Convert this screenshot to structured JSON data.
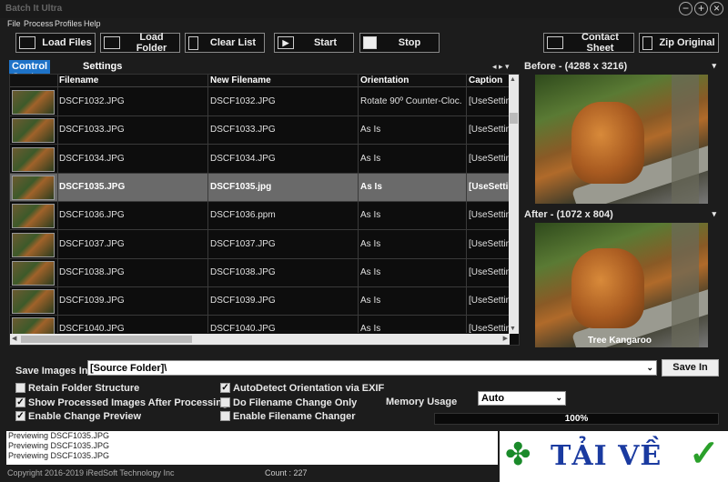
{
  "window": {
    "title": "Batch It Ultra",
    "controls": [
      "−",
      "+",
      "×"
    ]
  },
  "menu": [
    "File",
    "Process",
    "Profiles",
    "Help"
  ],
  "toolbar": {
    "load_files": "Load Files",
    "load_folder": "Load Folder",
    "clear_list": "Clear List",
    "start": "Start",
    "stop": "Stop",
    "contact_sheet": "Contact Sheet",
    "zip_original": "Zip Original"
  },
  "tabs": {
    "control_center": "Control Center",
    "settings": "Settings"
  },
  "tab_arrows": "◂ ▸ ▾",
  "grid": {
    "columns": [
      "Filename",
      "New Filename",
      "Orientation",
      "Caption"
    ],
    "rows": [
      {
        "filename": "DSCF1032.JPG",
        "new_filename": "DSCF1032.JPG",
        "orientation": "Rotate 90º Counter-Cloc...",
        "caption": "[UseSettin"
      },
      {
        "filename": "DSCF1033.JPG",
        "new_filename": "DSCF1033.JPG",
        "orientation": "As Is",
        "caption": "[UseSettin"
      },
      {
        "filename": "DSCF1034.JPG",
        "new_filename": "DSCF1034.JPG",
        "orientation": "As Is",
        "caption": "[UseSettin"
      },
      {
        "filename": "DSCF1035.JPG",
        "new_filename": "DSCF1035.jpg",
        "orientation": "As Is",
        "caption": "[UseSettin"
      },
      {
        "filename": "DSCF1036.JPG",
        "new_filename": "DSCF1036.ppm",
        "orientation": "As Is",
        "caption": "[UseSettin"
      },
      {
        "filename": "DSCF1037.JPG",
        "new_filename": "DSCF1037.JPG",
        "orientation": "As Is",
        "caption": "[UseSettin"
      },
      {
        "filename": "DSCF1038.JPG",
        "new_filename": "DSCF1038.JPG",
        "orientation": "As Is",
        "caption": "[UseSettin"
      },
      {
        "filename": "DSCF1039.JPG",
        "new_filename": "DSCF1039.JPG",
        "orientation": "As Is",
        "caption": "[UseSettin"
      },
      {
        "filename": "DSCF1040.JPG",
        "new_filename": "DSCF1040.JPG",
        "orientation": "As Is",
        "caption": "[UseSettin"
      }
    ],
    "selected_row": 3
  },
  "preview": {
    "before_label": "Before - (4288 x 3216)",
    "after_label": "After - (1072 x 804)",
    "after_caption": "Tree Kangaroo"
  },
  "save": {
    "label": "Save Images In",
    "value": "[Source Folder]\\",
    "button": "Save In"
  },
  "options": {
    "retain_folder": {
      "label": "Retain Folder Structure",
      "checked": false
    },
    "show_processed": {
      "label": "Show Processed Images After Processing",
      "checked": true
    },
    "enable_preview": {
      "label": "Enable Change Preview",
      "checked": true
    },
    "autodetect": {
      "label": "AutoDetect Orientation via EXIF",
      "checked": true
    },
    "filename_only": {
      "label": "Do Filename Change Only",
      "checked": false
    },
    "filename_changer": {
      "label": "Enable Filename Changer",
      "checked": false
    }
  },
  "memory": {
    "label": "Memory Usage",
    "value": "Auto"
  },
  "progress": {
    "value": 100,
    "text": "100%"
  },
  "log": [
    "Previewing DSCF1035.JPG",
    "Previewing DSCF1035.JPG",
    "Previewing DSCF1035.JPG"
  ],
  "status": {
    "copyright": "Copyright 2016-2019 iRedSoft Technology Inc",
    "count": "Count : 227"
  },
  "watermark": {
    "text": "TẢI VỀ"
  },
  "colors": {
    "accent": "#1e73c8",
    "selected_row": "#6a6a6a",
    "background": "#1c1c1c"
  }
}
